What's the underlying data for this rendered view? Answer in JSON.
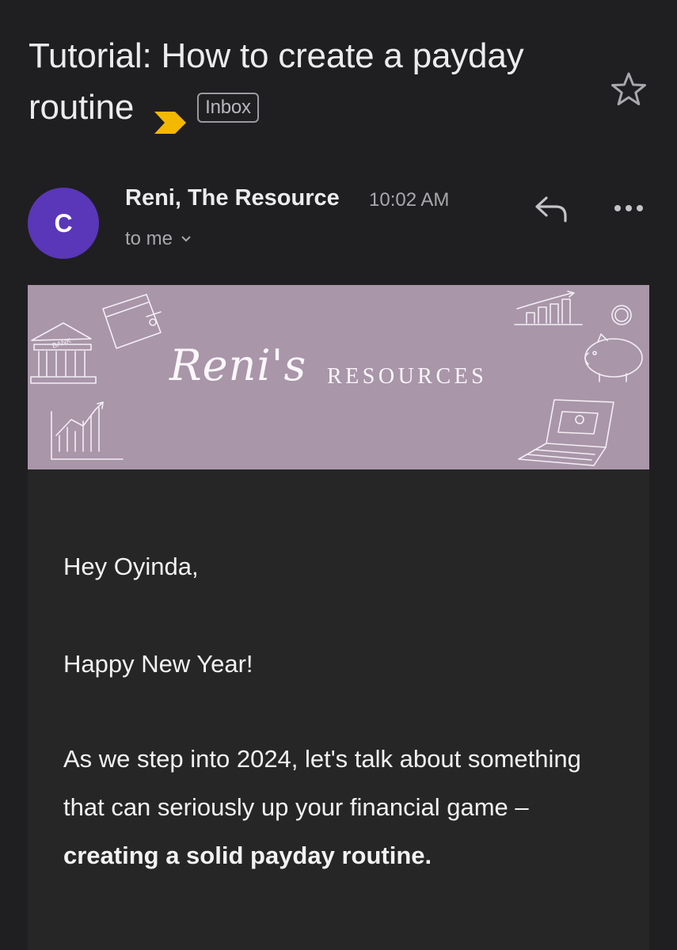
{
  "subject": {
    "line1": "Tutorial: How to create a payday",
    "line2": "routine",
    "label": "Inbox"
  },
  "sender": {
    "initial": "C",
    "name": "Reni, The Resource",
    "time": "10:02 AM",
    "to": "to me"
  },
  "banner": {
    "script": "Reni's",
    "word": "RESOURCES",
    "bank_sign": "BANK",
    "background": "#a996a9"
  },
  "body": {
    "greeting": "Hey Oyinda,",
    "wish": "Happy New Year!",
    "para_start": "As we step into 2024, let's talk about something that can seriously up your financial game – ",
    "para_bold": "creating a solid payday routine."
  },
  "colors": {
    "background": "#1f1f21",
    "avatar": "#5a36b9",
    "importance": "#f5b800",
    "content_bg": "#262626"
  },
  "icons": {
    "star": "star-icon",
    "reply": "reply-icon",
    "more": "more-icon",
    "chevron": "chevron-down-icon",
    "importance": "importance-marker-icon"
  }
}
